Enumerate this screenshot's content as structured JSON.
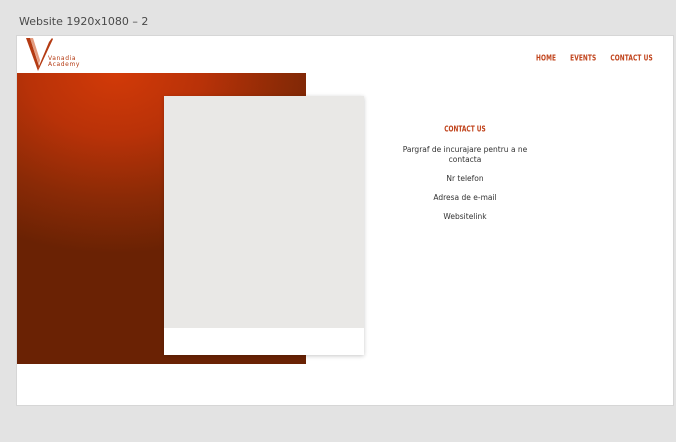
{
  "frame": {
    "title": "Website 1920x1080 – 2"
  },
  "logo": {
    "line1": "Vanadia",
    "line2": "Academy"
  },
  "nav": {
    "items": [
      "HOME",
      "EVENTS",
      "CONTACT US"
    ]
  },
  "contact": {
    "title": "CONTACT US",
    "paragraph": "Pargraf de incurajare pentru a ne contacta",
    "phone": "Nr telefon",
    "email": "Adresa de e-mail",
    "website": "Websitelink"
  },
  "colors": {
    "accent": "#c0421a",
    "gradient_top": "#d23a08",
    "gradient_bottom": "#6a2204",
    "card_placeholder": "#e9e8e6"
  }
}
